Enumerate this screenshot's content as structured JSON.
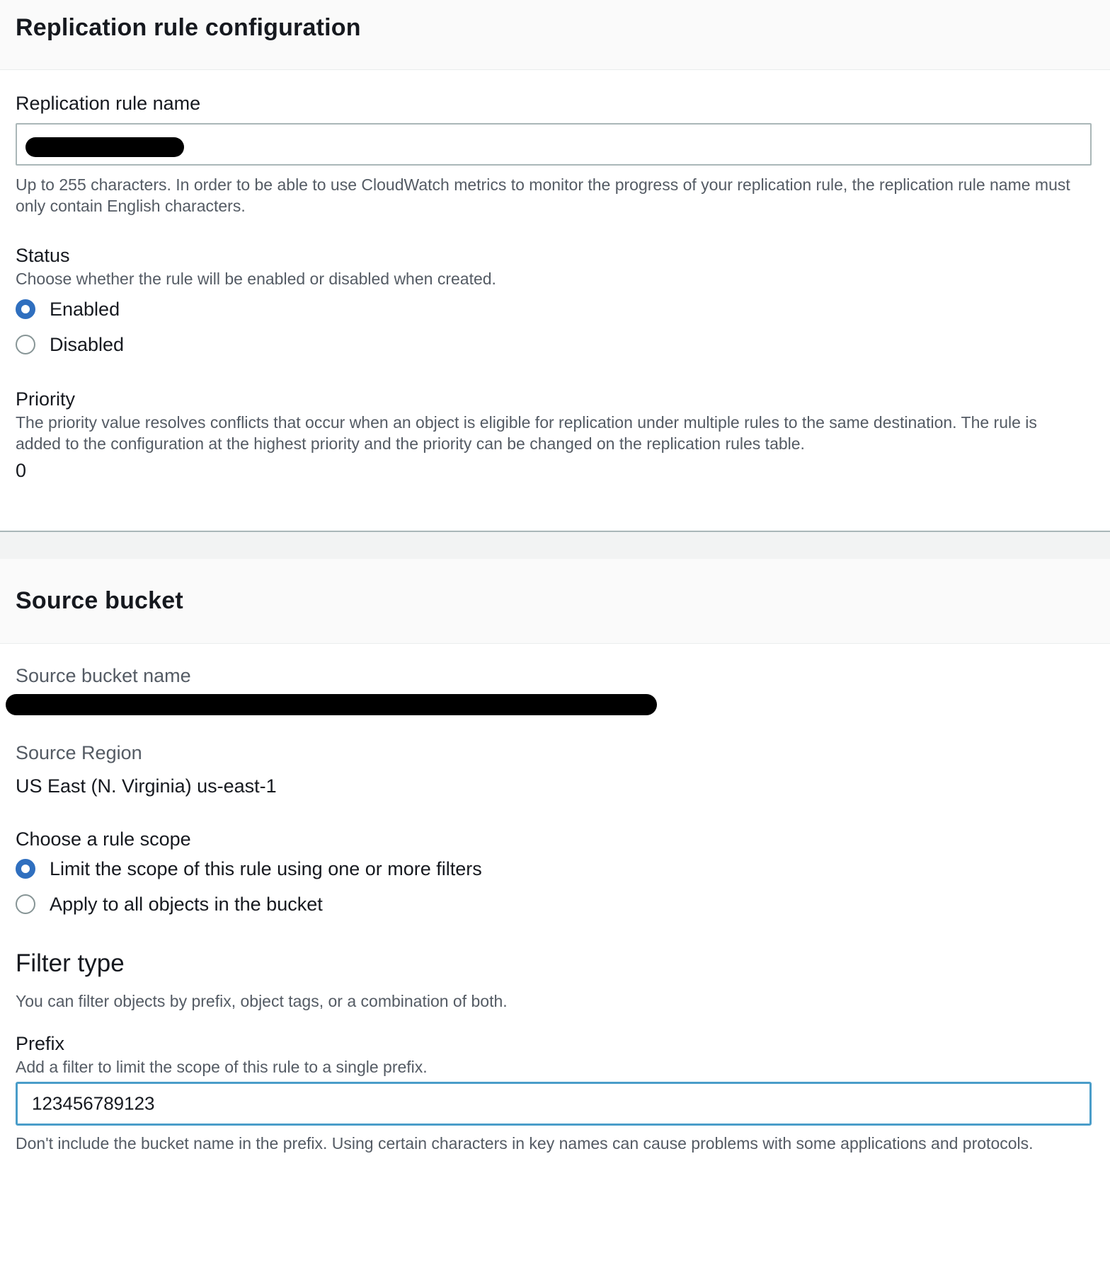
{
  "rule_config": {
    "title": "Replication rule configuration",
    "name_label": "Replication rule name",
    "name_help": "Up to 255 characters. In order to be able to use CloudWatch metrics to monitor the progress of your replication rule, the replication rule name must only contain English characters.",
    "status_label": "Status",
    "status_desc": "Choose whether the rule will be enabled or disabled when created.",
    "status_options": [
      "Enabled",
      "Disabled"
    ],
    "status_selected": "Enabled",
    "priority_label": "Priority",
    "priority_desc": "The priority value resolves conflicts that occur when an object is eligible for replication under multiple rules to the same destination. The rule is added to the configuration at the highest priority and the priority can be changed on the replication rules table.",
    "priority_value": "0"
  },
  "source_bucket": {
    "title": "Source bucket",
    "name_label": "Source bucket name",
    "region_label": "Source Region",
    "region_value": "US East (N. Virginia) us-east-1",
    "scope_label": "Choose a rule scope",
    "scope_options": [
      "Limit the scope of this rule using one or more filters",
      "Apply to all objects in the bucket"
    ],
    "scope_selected": "Limit the scope of this rule using one or more filters",
    "filter_title": "Filter type",
    "filter_desc": "You can filter objects by prefix, object tags, or a combination of both.",
    "prefix_label": "Prefix",
    "prefix_desc": "Add a filter to limit the scope of this rule to a single prefix.",
    "prefix_value": "123456789123",
    "prefix_help": "Don't include the bucket name in the prefix. Using certain characters in key names can cause problems with some applications and protocols."
  }
}
